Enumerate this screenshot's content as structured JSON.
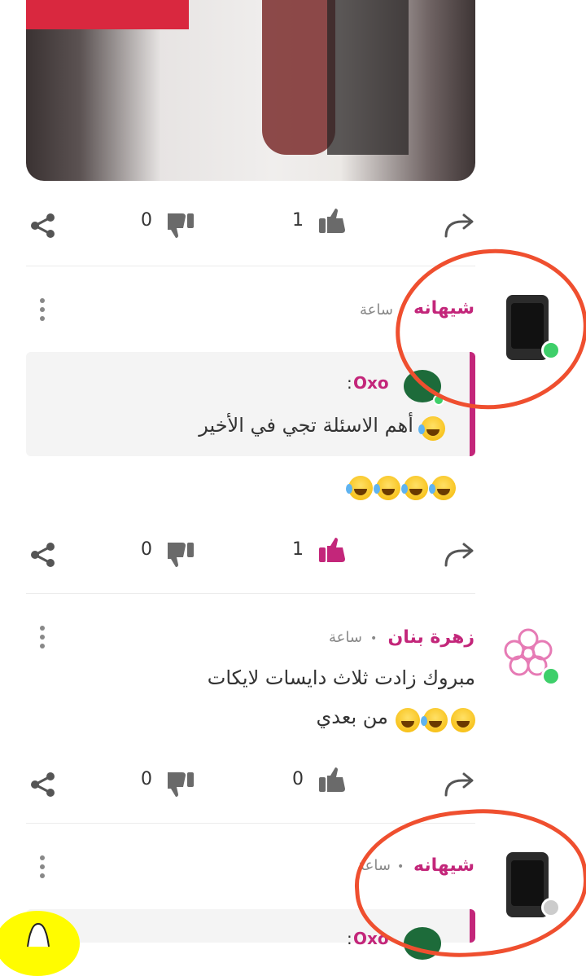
{
  "post": {
    "actions": {
      "dislikes": "0",
      "likes": "1"
    }
  },
  "comments": [
    {
      "author": "شيهانه",
      "time": "ساعة",
      "quote": {
        "author": "Oxo",
        "colon": ":",
        "text": "أهم الاسئلة تجي في الأخير"
      },
      "text": "",
      "actions": {
        "dislikes": "0",
        "likes": "1",
        "liked": true
      }
    },
    {
      "author": "زهرة بنان",
      "time": "ساعة",
      "text_line1": "مبروك زادت ثلاث دايسات لايكات",
      "text_line2": "من بعدي",
      "actions": {
        "dislikes": "0",
        "likes": "0"
      }
    },
    {
      "author": "شيهانه",
      "time": "ساعة",
      "quote": {
        "author": "Oxo",
        "colon": ":"
      }
    }
  ],
  "colors": {
    "accent": "#c3267a",
    "online": "#3ecf6a",
    "offline": "#cccccc",
    "annotation": "#ef4f2f"
  }
}
